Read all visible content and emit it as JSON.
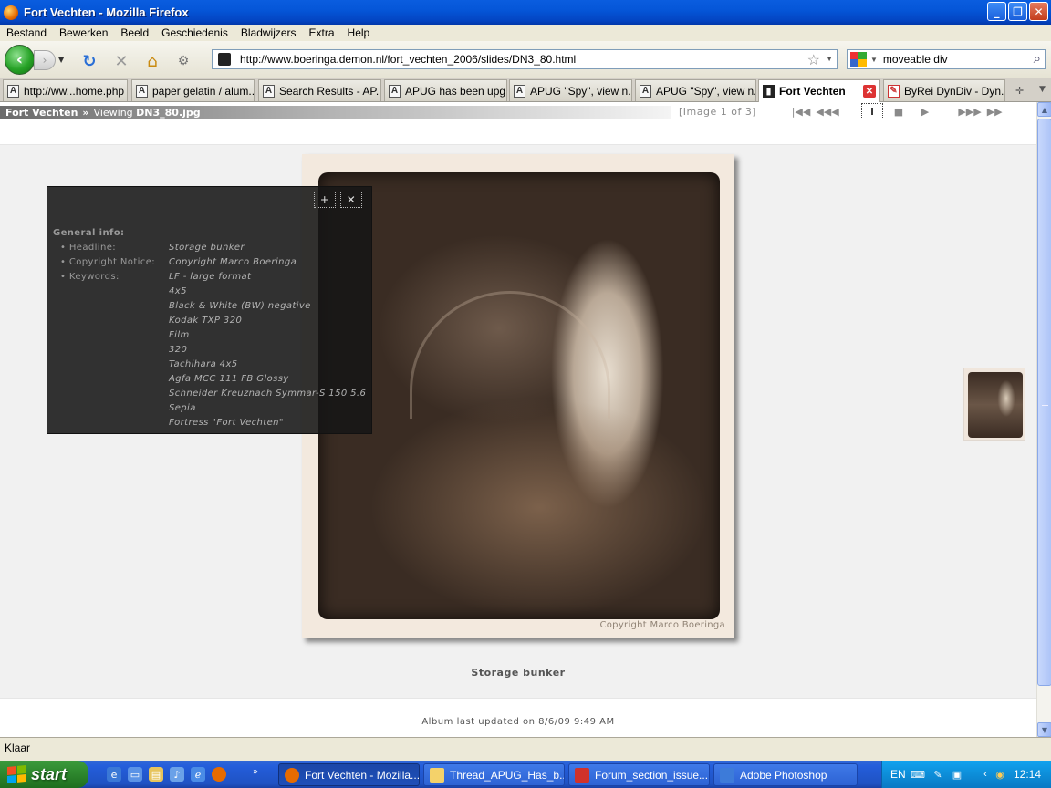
{
  "window": {
    "title": "Fort Vechten - Mozilla Firefox",
    "buttons": {
      "minimize": "_",
      "maximize": "❐",
      "close": "✕"
    }
  },
  "menu": [
    "Bestand",
    "Bewerken",
    "Beeld",
    "Geschiedenis",
    "Bladwijzers",
    "Extra",
    "Help"
  ],
  "nav": {
    "url": "http://www.boeringa.demon.nl/fort_vechten_2006/slides/DN3_80.html",
    "search_value": "moveable div",
    "icons": {
      "back": "back-arrow-icon",
      "forward": "forward-arrow-icon",
      "reload": "reload-icon",
      "stop": "stop-icon",
      "home": "home-icon",
      "addon": "addon-icon",
      "bookmark": "star-icon",
      "search": "magnifier-icon"
    }
  },
  "tabs": [
    {
      "label": "http://ww...home.php",
      "icon": "A"
    },
    {
      "label": "paper gelatin / alum...",
      "icon": "A"
    },
    {
      "label": "Search Results - AP...",
      "icon": "A"
    },
    {
      "label": "APUG has been upg...",
      "icon": "A"
    },
    {
      "label": "APUG \"Spy\", view n...",
      "icon": "A"
    },
    {
      "label": "APUG \"Spy\", view n...",
      "icon": "A"
    },
    {
      "label": "Fort Vechten",
      "icon": "▮",
      "active": true
    },
    {
      "label": "ByRei DynDiv - Dyn...",
      "icon": "✎"
    }
  ],
  "page": {
    "breadcrumb": {
      "album": "Fort Vechten",
      "separator": "»",
      "prefix": "Viewing",
      "file": "DN3_80.jpg"
    },
    "image_counter": "[Image 1 of 3]",
    "controls": {
      "first": "|◀◀",
      "prev": "◀◀◀",
      "info": "i",
      "stop": "■",
      "play": "▶",
      "next": "▶▶▶",
      "last": "▶▶|"
    },
    "info_panel": {
      "heading": "General info:",
      "buttons": {
        "expand": "+",
        "close": "✕"
      },
      "rows": [
        {
          "label": "• Headline:",
          "values": [
            "Storage bunker"
          ]
        },
        {
          "label": "• Copyright Notice:",
          "values": [
            "Copyright Marco Boeringa"
          ]
        },
        {
          "label": "• Keywords:",
          "values": [
            "LF - large format",
            "4x5",
            "Black & White (BW) negative",
            "Kodak TXP 320",
            "Film",
            "320",
            "Tachihara 4x5",
            "Agfa MCC 111 FB Glossy",
            "Schneider Kreuznach Symmar-S 150 5.6",
            "Sepia",
            "Fortress \"Fort Vechten\""
          ]
        }
      ]
    },
    "watermark": "Copyright Marco Boeringa",
    "caption": "Storage bunker",
    "updated": "Album last updated on 8/6/09 9:49 AM"
  },
  "status": "Klaar",
  "taskbar": {
    "start": "start",
    "tasks": [
      {
        "label": "Fort Vechten - Mozilla...",
        "active": true,
        "color": "#e66b00"
      },
      {
        "label": "Thread_APUG_Has_b...",
        "active": false,
        "color": "#f4d26a"
      },
      {
        "label": "Forum_section_issue...",
        "active": false,
        "color": "#d0322b"
      },
      {
        "label": "Adobe Photoshop",
        "active": false,
        "color": "#3d7bd9"
      }
    ],
    "tray": {
      "language": "EN",
      "clock": "12:14"
    }
  }
}
